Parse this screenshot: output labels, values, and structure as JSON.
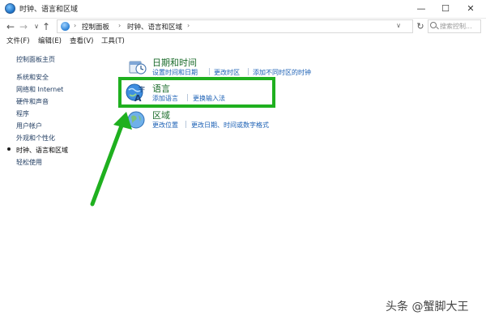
{
  "window": {
    "title": "时钟、语言和区域",
    "minimize": "—",
    "maximize": "☐",
    "close": "✕"
  },
  "nav": {
    "back": "←",
    "forward": "→",
    "dropdown": "∨",
    "up": "↑",
    "refresh": "↻"
  },
  "address": {
    "crumbs": [
      "控制面板",
      "时钟、语言和区域"
    ],
    "separator": "›",
    "dropdown": "∨"
  },
  "search": {
    "placeholder": "搜索控制..."
  },
  "menu": {
    "items": [
      "文件(F)",
      "编辑(E)",
      "查看(V)",
      "工具(T)"
    ]
  },
  "sidebar": {
    "items": [
      {
        "label": "控制面板主页"
      },
      {
        "label": "系统和安全"
      },
      {
        "label": "网络和 Internet"
      },
      {
        "label": "硬件和声音"
      },
      {
        "label": "程序"
      },
      {
        "label": "用户帐户"
      },
      {
        "label": "外观和个性化"
      },
      {
        "label": "时钟、语言和区域",
        "active": true
      },
      {
        "label": "轻松使用"
      }
    ]
  },
  "categories": [
    {
      "title": "日期和时间",
      "links": [
        "设置时间和日期",
        "更改时区",
        "添加不同时区的时钟"
      ]
    },
    {
      "title": "语言",
      "links": [
        "添加语言",
        "更换输入法"
      ]
    },
    {
      "title": "区域",
      "links": [
        "更改位置",
        "更改日期、时间或数字格式"
      ]
    }
  ],
  "colors": {
    "highlight": "#1fb01f",
    "arrow": "#1fb01f",
    "link": "#1a5fb4",
    "category_title": "#1a6b2a"
  },
  "watermark": "头条 @蟹脚大王"
}
